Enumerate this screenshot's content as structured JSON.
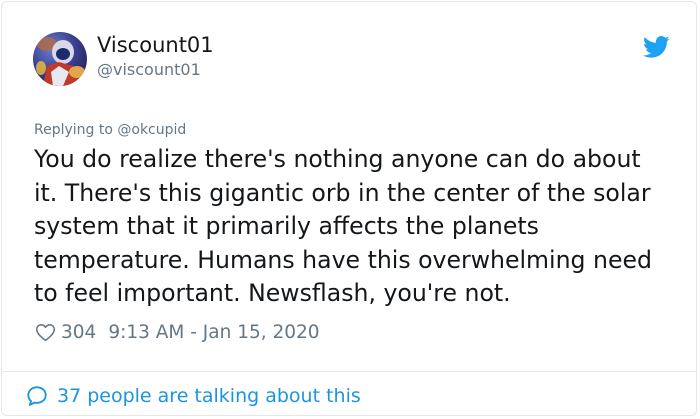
{
  "colors": {
    "text": "#14171a",
    "secondary": "#657786",
    "link": "#1b95e0",
    "twitter_blue": "#1da1f2",
    "border": "#e1e8ed"
  },
  "author": {
    "display_name": "Viscount01",
    "handle": "@viscount01",
    "avatar_icon": "avatar-image"
  },
  "brand_icon": "twitter-bird-icon",
  "tweet": {
    "replying_to": "Replying to @okcupid",
    "lines": [
      "You do realize there's nothing anyone can do about",
      "it. There's this gigantic orb in the center of the solar",
      "system that it primarily affects the planets",
      "temperature. Humans have this overwhelming need",
      "to feel important. Newsflash, you're not."
    ],
    "likes": "304",
    "timestamp": "9:13 AM - Jan 15, 2020"
  },
  "footer": {
    "talking_label": "37 people are talking about this",
    "icon": "speech-bubble-icon"
  }
}
